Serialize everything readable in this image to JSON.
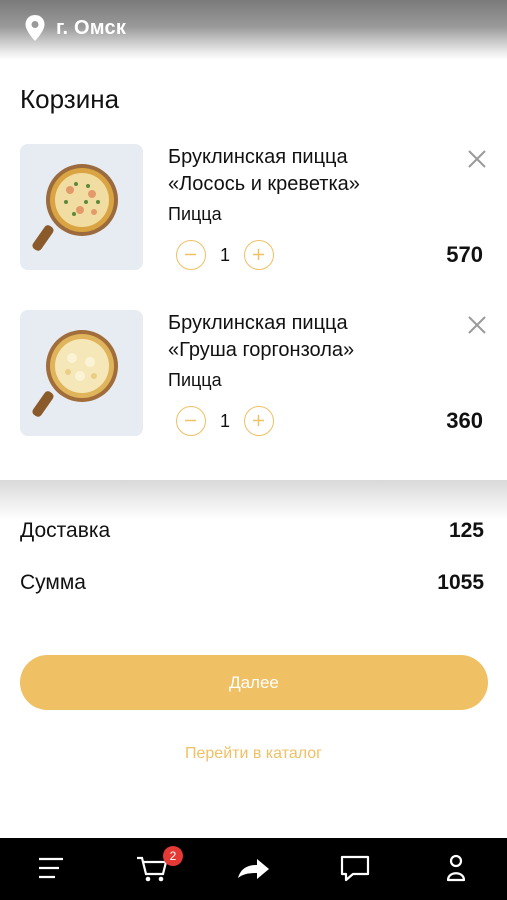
{
  "header": {
    "city": "г. Омск",
    "location_icon": "map-pin-icon"
  },
  "cart": {
    "title": "Корзина",
    "items": [
      {
        "name_line1": "Бруклинская пицца",
        "name_line2": "«Лосось и креветка»",
        "category": "Пицца",
        "quantity": "1",
        "price": "570"
      },
      {
        "name_line1": "Бруклинская пицца",
        "name_line2": "«Груша горгонзола»",
        "category": "Пицца",
        "quantity": "1",
        "price": "360"
      }
    ]
  },
  "summary": {
    "delivery_label": "Доставка",
    "delivery_value": "125",
    "total_label": "Сумма",
    "total_value": "1055"
  },
  "actions": {
    "next_label": "Далее",
    "catalog_link": "Перейти в каталог"
  },
  "tabbar": {
    "cart_badge": "2",
    "icons": [
      "menu-icon",
      "cart-icon",
      "share-icon",
      "chat-icon",
      "profile-icon"
    ]
  },
  "colors": {
    "accent": "#f0c064",
    "badge": "#e53935",
    "tabbar_bg": "#000000"
  }
}
